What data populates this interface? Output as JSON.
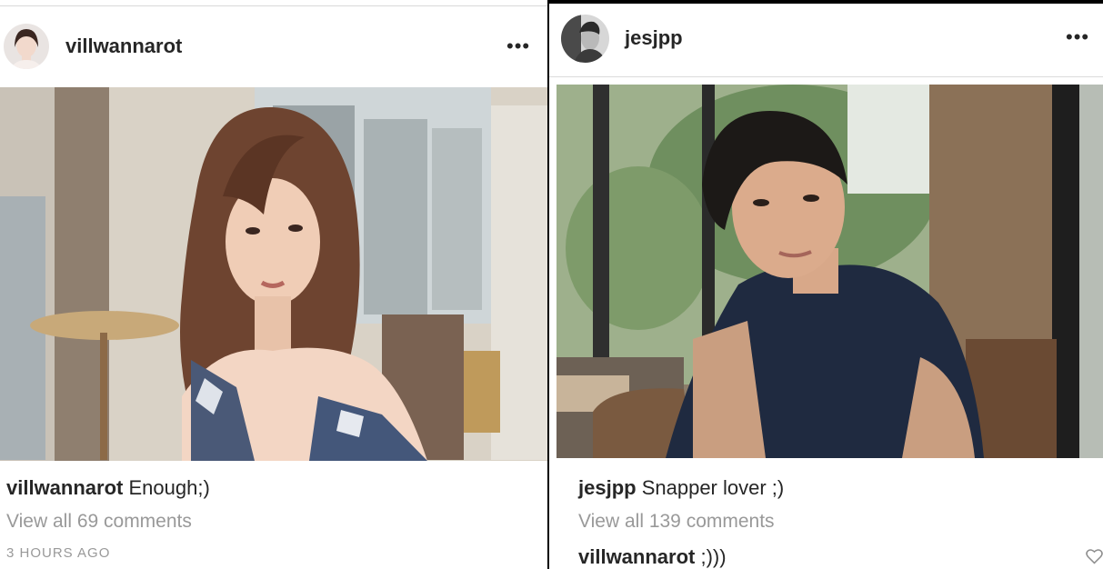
{
  "left_post": {
    "username": "villwannarot",
    "caption_user": "villwannarot",
    "caption_text": "Enough;)",
    "view_all": "View all 69 comments",
    "timestamp": "3 HOURS AGO",
    "more_icon": "•••"
  },
  "right_post": {
    "username": "jesjpp",
    "caption_user": "jesjpp",
    "caption_text": "Snapper lover ;)",
    "view_all": "View all 139 comments",
    "comment_user": "villwannarot",
    "comment_text": ";)))",
    "more_icon": "•••"
  },
  "colors": {
    "text": "#262626",
    "muted": "#999999",
    "divider": "#dbdbdb"
  }
}
